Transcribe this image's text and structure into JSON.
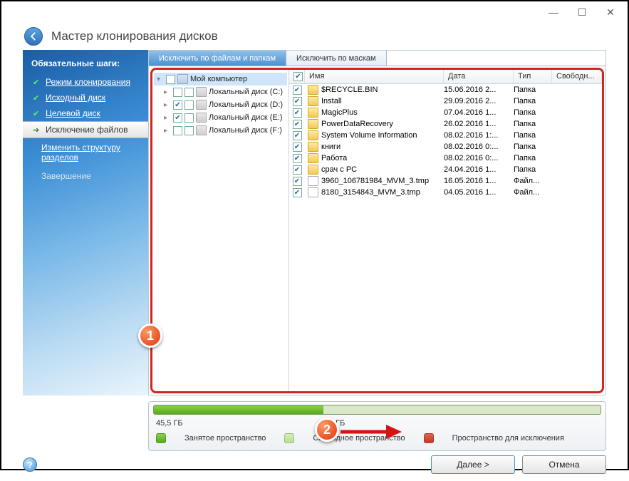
{
  "window": {
    "title": "Мастер клонирования дисков"
  },
  "sidebar": {
    "heading": "Обязательные шаги:",
    "items": [
      {
        "label": "Режим клонирования",
        "state": "done"
      },
      {
        "label": "Исходный диск",
        "state": "done"
      },
      {
        "label": "Целевой диск",
        "state": "done"
      },
      {
        "label": "Исключение файлов",
        "state": "current"
      }
    ],
    "link": "Изменить структуру разделов",
    "final": "Завершение"
  },
  "tabs": {
    "active": "Исключить по файлам и папкам",
    "inactive": "Исключить по маскам"
  },
  "tree": {
    "root": "Мой компьютер",
    "drives": [
      {
        "label": "Локальный диск (C:)",
        "checked": false
      },
      {
        "label": "Локальный диск (D:)",
        "checked": true
      },
      {
        "label": "Локальный диск (E:)",
        "checked": true
      },
      {
        "label": "Локальный диск (F:)",
        "checked": false
      }
    ]
  },
  "columns": {
    "name": "Имя",
    "date": "Дата",
    "type": "Тип",
    "free": "Свободн..."
  },
  "files": [
    {
      "name": "$RECYCLE.BIN",
      "date": "15.06.2016 2...",
      "type": "Папка",
      "icon": "folder"
    },
    {
      "name": "Install",
      "date": "29.09.2016 2...",
      "type": "Папка",
      "icon": "folder"
    },
    {
      "name": "MagicPlus",
      "date": "07.04.2016 1...",
      "type": "Папка",
      "icon": "folder"
    },
    {
      "name": "PowerDataRecovery",
      "date": "26.02.2016 1...",
      "type": "Папка",
      "icon": "folder"
    },
    {
      "name": "System Volume Information",
      "date": "08.02.2016 1:...",
      "type": "Папка",
      "icon": "folder"
    },
    {
      "name": "книги",
      "date": "08.02.2016 0:...",
      "type": "Папка",
      "icon": "folder"
    },
    {
      "name": "Работа",
      "date": "08.02.2016 0:...",
      "type": "Папка",
      "icon": "folder"
    },
    {
      "name": "срач с PC",
      "date": "24.04.2016 1...",
      "type": "Папка",
      "icon": "folder"
    },
    {
      "name": "3960_106781984_MVM_3.tmp",
      "date": "16.05.2016 1...",
      "type": "Файл...",
      "icon": "file"
    },
    {
      "name": "8180_3154843_MVM_3.tmp",
      "date": "04.05.2016 1...",
      "type": "Файл...",
      "icon": "file"
    }
  ],
  "progress": {
    "used_label": "45,5 ГБ",
    "total_label": "66,3 ГБ",
    "used_percent": 38
  },
  "legend": {
    "used": "Занятое пространство",
    "free": "Свободное пространство",
    "excl": "Пространство для исключения"
  },
  "buttons": {
    "next": "Далее >",
    "cancel": "Отмена"
  },
  "annotations": {
    "one": "1",
    "two": "2"
  }
}
